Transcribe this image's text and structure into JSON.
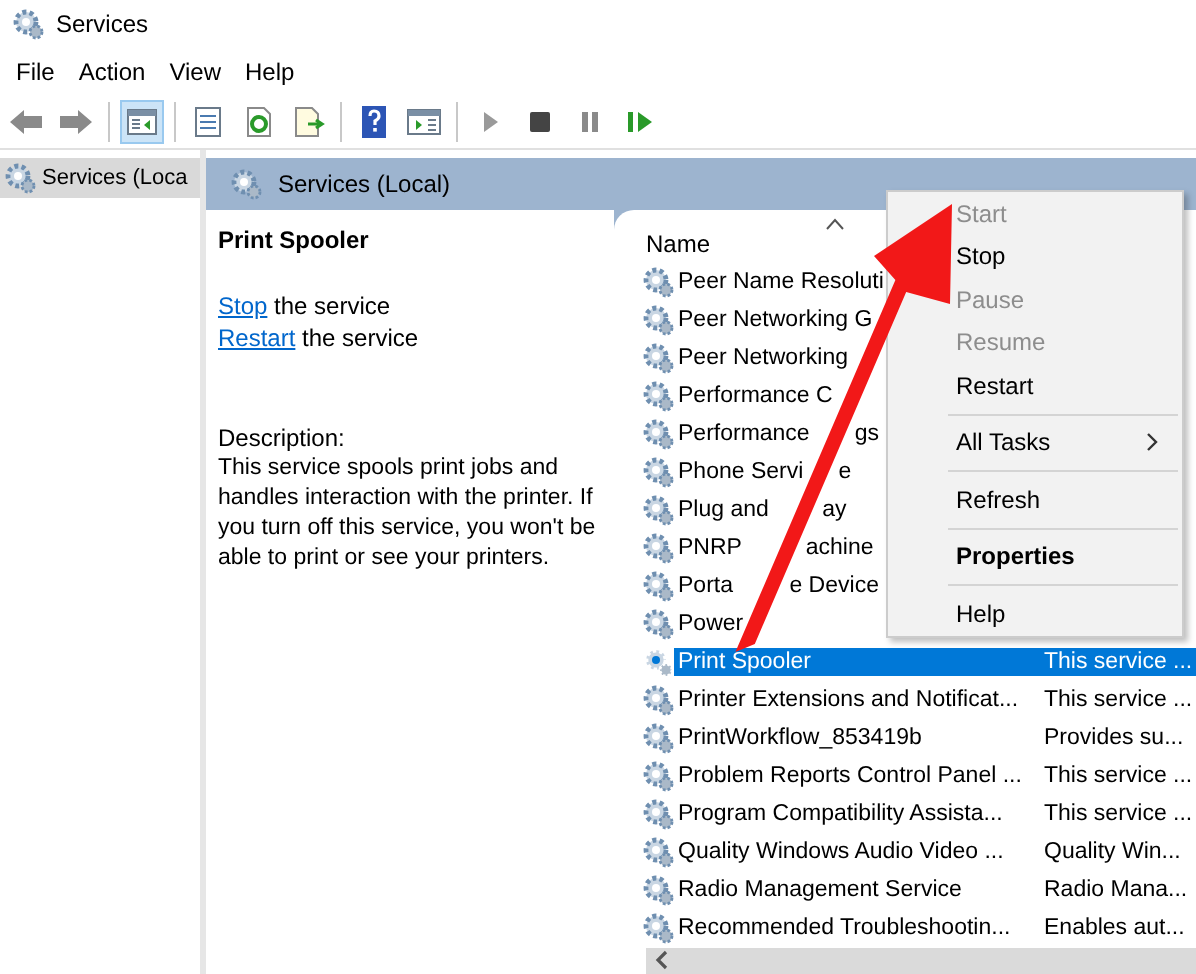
{
  "window": {
    "title": "Services"
  },
  "menu": [
    "File",
    "Action",
    "View",
    "Help"
  ],
  "toolbar": [
    {
      "kind": "back",
      "pressed": false
    },
    {
      "kind": "forward",
      "pressed": false
    },
    {
      "kind": "sep"
    },
    {
      "kind": "tree",
      "pressed": true
    },
    {
      "kind": "sep"
    },
    {
      "kind": "properties",
      "pressed": false
    },
    {
      "kind": "refresh",
      "pressed": false
    },
    {
      "kind": "export",
      "pressed": false
    },
    {
      "kind": "sep"
    },
    {
      "kind": "help",
      "pressed": false
    },
    {
      "kind": "console",
      "pressed": false
    },
    {
      "kind": "sep"
    },
    {
      "kind": "play",
      "pressed": false
    },
    {
      "kind": "stop",
      "pressed": false
    },
    {
      "kind": "pause",
      "pressed": false
    },
    {
      "kind": "resume",
      "pressed": false
    }
  ],
  "tree": [
    {
      "label": "Services (Loca",
      "selected": true
    }
  ],
  "pane": {
    "title": "Services (Local)",
    "service_name": "Print Spooler",
    "actions": [
      {
        "link": "Stop",
        "text": " the service"
      },
      {
        "link": "Restart",
        "text": " the service"
      }
    ],
    "description_label": "Description:",
    "description": "This service spools print jobs and handles interaction with the printer. If you turn off this service, you won't be able to print or see your printers."
  },
  "list": {
    "columns": [
      {
        "label": "Name",
        "sorted": true
      }
    ],
    "rows": [
      {
        "name": "Peer Name Resoluti",
        "selected": false
      },
      {
        "name": "Peer Networking G",
        "selected": false
      },
      {
        "name": "Peer Networking",
        "selected": false
      },
      {
        "name": "Performance C",
        "selected": false
      },
      {
        "name": "Performance",
        "name_tail": "gs",
        "selected": false
      },
      {
        "name": "Phone Servi",
        "name_tail": "e",
        "selected": false
      },
      {
        "name": "Plug and",
        "name_tail": "ay",
        "selected": false
      },
      {
        "name": "PNRP",
        "name_tail": "achine",
        "selected": false
      },
      {
        "name": "Porta",
        "name_tail": "e Device",
        "selected": false
      },
      {
        "name": "Power",
        "selected": false
      },
      {
        "name": "Print Spooler",
        "description": "This service ...",
        "selected": true
      },
      {
        "name": "Printer Extensions and Notificat...",
        "description": "This service ...",
        "selected": false
      },
      {
        "name": "PrintWorkflow_853419b",
        "description": "Provides su...",
        "selected": false
      },
      {
        "name": "Problem Reports Control Panel ...",
        "description": "This service ...",
        "selected": false
      },
      {
        "name": "Program Compatibility Assista...",
        "description": "This service ...",
        "selected": false
      },
      {
        "name": "Quality Windows Audio Video ...",
        "description": "Quality Win...",
        "selected": false
      },
      {
        "name": "Radio Management Service",
        "description": "Radio Mana...",
        "selected": false
      },
      {
        "name": "Recommended Troubleshootin...",
        "description": "Enables aut...",
        "selected": false
      }
    ]
  },
  "context_menu": {
    "items": [
      {
        "kind": "item",
        "label": "Start",
        "disabled": true
      },
      {
        "kind": "item",
        "label": "Stop",
        "disabled": false
      },
      {
        "kind": "item",
        "label": "Pause",
        "disabled": true
      },
      {
        "kind": "item",
        "label": "Resume",
        "disabled": true
      },
      {
        "kind": "item",
        "label": "Restart",
        "disabled": false
      },
      {
        "kind": "separator"
      },
      {
        "kind": "submenu",
        "label": "All Tasks",
        "disabled": false
      },
      {
        "kind": "separator"
      },
      {
        "kind": "item",
        "label": "Refresh",
        "disabled": false
      },
      {
        "kind": "separator"
      },
      {
        "kind": "default",
        "label": "Properties",
        "disabled": false
      },
      {
        "kind": "separator"
      },
      {
        "kind": "item",
        "label": "Help",
        "disabled": false
      }
    ]
  }
}
